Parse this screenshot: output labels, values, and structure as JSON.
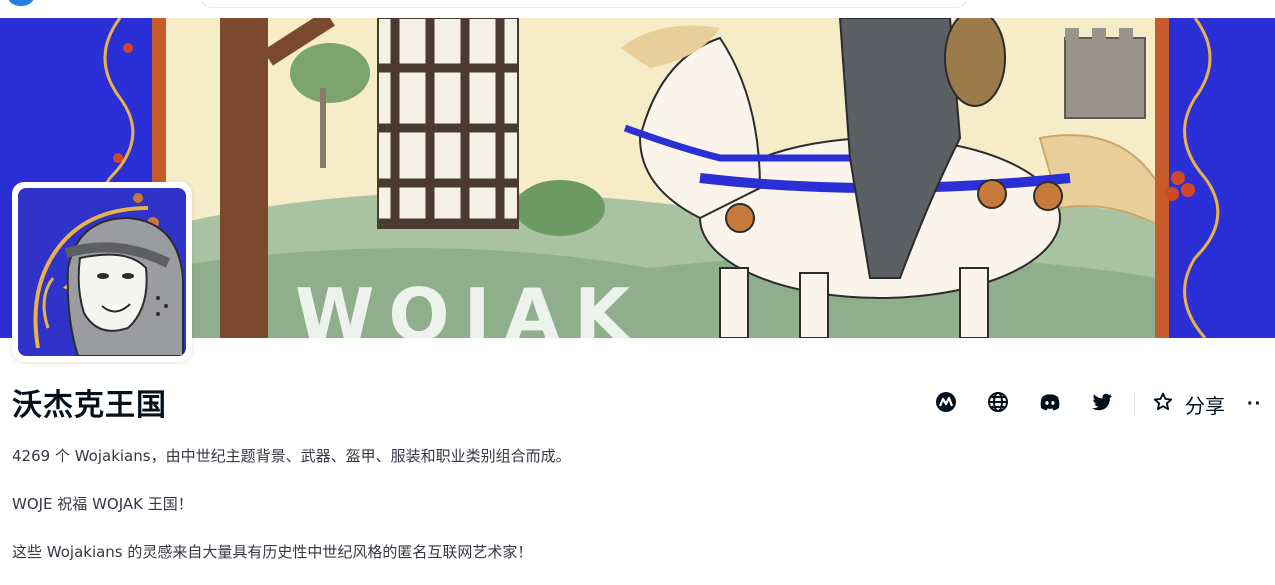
{
  "collection": {
    "title": "沃杰克王国",
    "description_lines": [
      "4269 个 Wojakians，由中世纪主题背景、武器、盔甲、服装和职业类别组合而成。",
      "WOJE 祝福 WOJAK 王国！",
      "这些 Wojakians 的灵感来自大量具有历史性中世纪风格的匿名互联网艺术家！"
    ]
  },
  "banner": {
    "partial_text": "WOJAK"
  },
  "actions": {
    "icons": [
      "activity-icon",
      "globe-icon",
      "discord-icon",
      "twitter-icon",
      "star-icon"
    ],
    "share_label": "分享",
    "more_label": "··"
  },
  "colors": {
    "border_blue": "#2b2fd6",
    "parchment": "#f7ecc8",
    "hill_green": "#8fae8c",
    "text_dark": "#04111d",
    "text_body": "#353840",
    "accent_blue": "#2081e2"
  }
}
